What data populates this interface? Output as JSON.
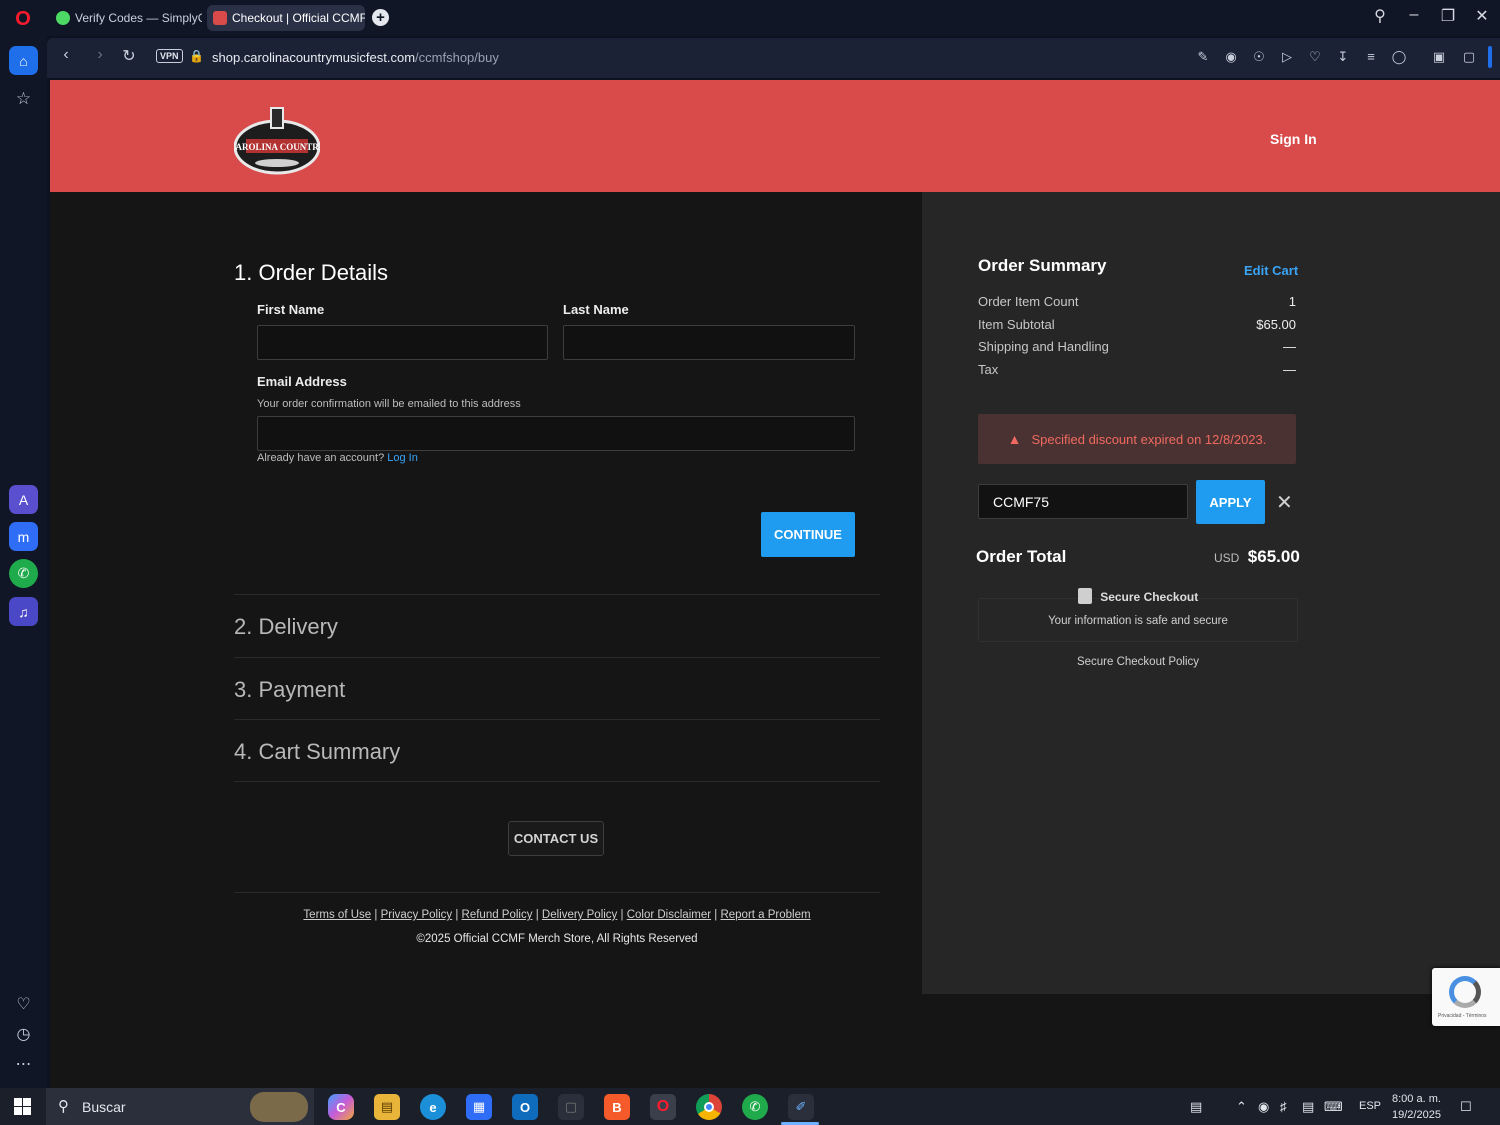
{
  "browser": {
    "tabs": [
      {
        "label": "Verify Codes — SimplyCodes",
        "active": false
      },
      {
        "label": "Checkout | Official CCMF Merch Store",
        "active": true
      }
    ],
    "vpn_label": "VPN",
    "url_domain": "shop.carolinacountrymusicfest.com",
    "url_path": "/ccmfshop/buy"
  },
  "header": {
    "logo_text": "CAROLINA COUNTRY",
    "signin": "Sign In"
  },
  "order_details": {
    "title": "1. Order Details",
    "first_name_label": "First Name",
    "first_name_value": "",
    "last_name_label": "Last Name",
    "last_name_value": "",
    "email_label": "Email Address",
    "email_hint": "Your order confirmation will be emailed to this address",
    "email_value": "",
    "account_prompt": "Already have an account?",
    "login_link": "Log In",
    "continue_button": "CONTINUE"
  },
  "steps": [
    {
      "label": "2. Delivery"
    },
    {
      "label": "3. Payment"
    },
    {
      "label": "4. Cart Summary"
    }
  ],
  "contact_button": "CONTACT US",
  "footer": {
    "links": [
      "Terms of Use",
      "Privacy Policy",
      "Refund Policy",
      "Delivery Policy",
      "Color Disclaimer",
      "Report a Problem"
    ],
    "copyright": "©2025 Official CCMF Merch Store, All Rights Reserved"
  },
  "order_summary": {
    "title": "Order Summary",
    "edit_cart": "Edit Cart",
    "rows": [
      {
        "label": "Order Item Count",
        "value": "1"
      },
      {
        "label": "Item Subtotal",
        "value": "$65.00"
      },
      {
        "label": "Shipping and Handling",
        "value": "—"
      },
      {
        "label": "Tax",
        "value": "—"
      }
    ],
    "alert": "Specified discount expired on 12/8/2023.",
    "discount_code": "CCMF75",
    "apply_button": "APPLY",
    "total_label": "Order Total",
    "total_currency": "USD",
    "total_value": "$65.00",
    "secure_title": "Secure Checkout",
    "secure_sub": "Your information is safe and secure",
    "secure_policy": "Secure Checkout Policy"
  },
  "recaptcha_text": "Privacidad - Términos",
  "taskbar": {
    "search_placeholder": "Buscar",
    "lang": "ESP",
    "time": "8:00 a. m.",
    "date": "19/2/2025"
  },
  "colors": {
    "header_red": "#d94a4a",
    "accent_blue": "#1f9cf0",
    "alert_bg": "#4a3232",
    "alert_text": "#f06a5f"
  }
}
